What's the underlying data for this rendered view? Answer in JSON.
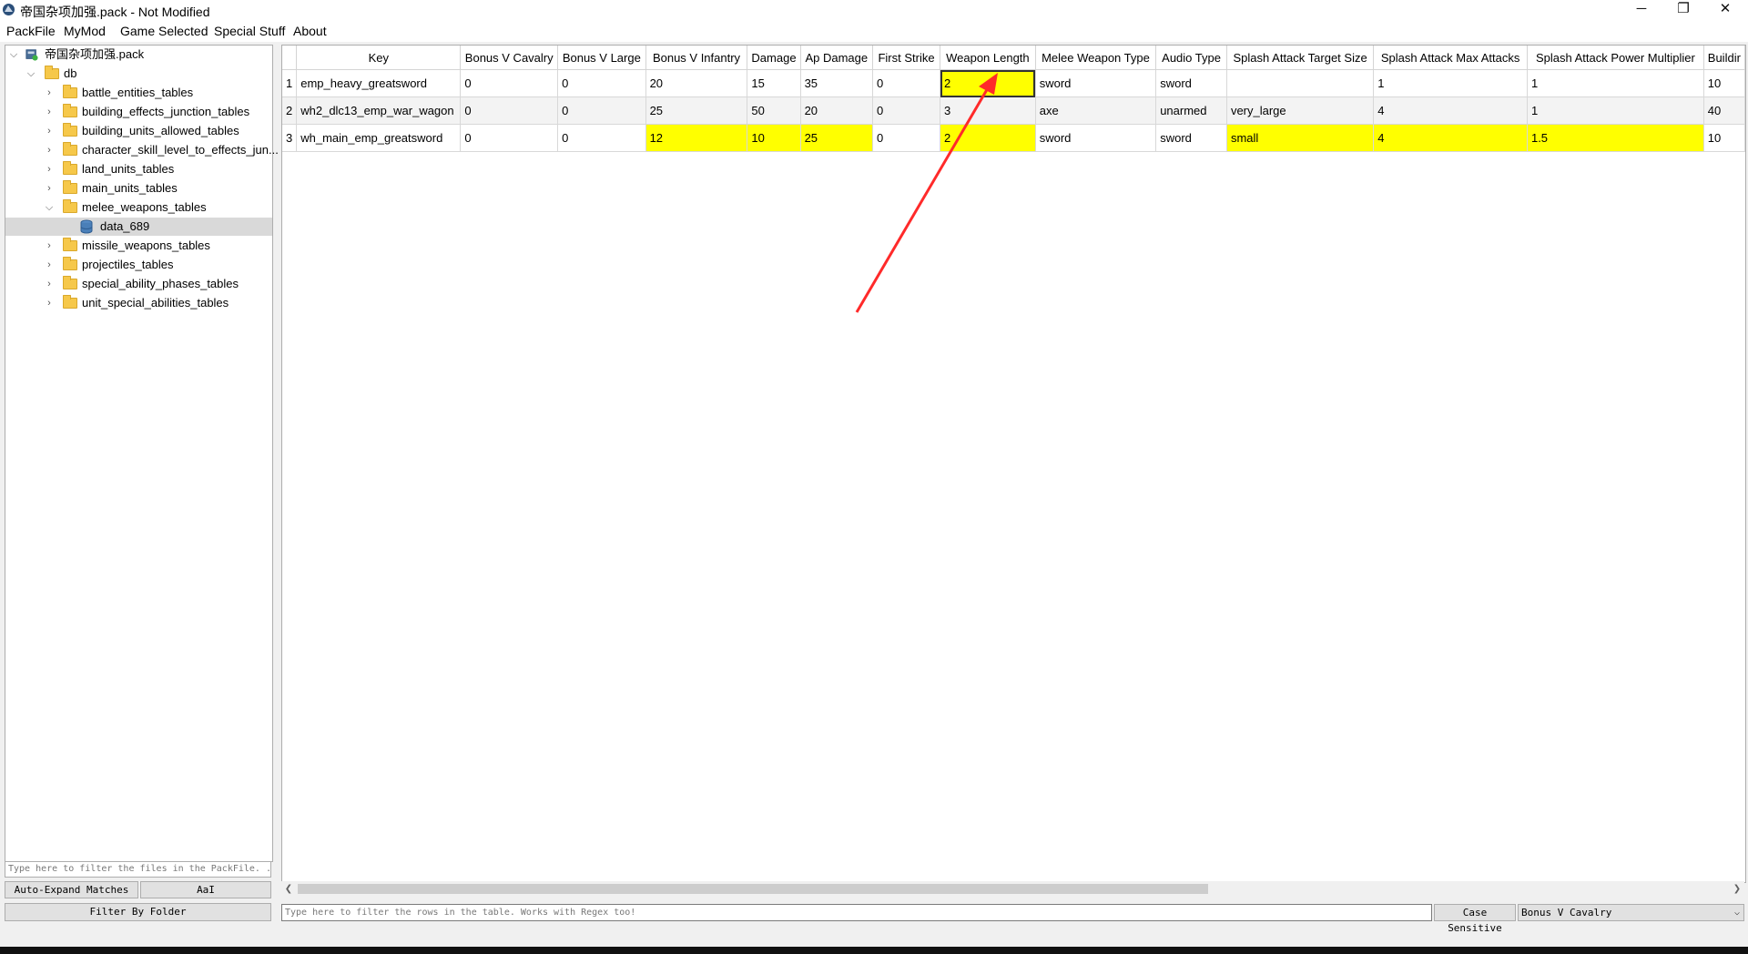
{
  "window": {
    "title": "帝国杂项加强.pack - Not Modified",
    "minimize": "─",
    "maximize": "❐",
    "close": "✕"
  },
  "menu": [
    {
      "label": "PackFile"
    },
    {
      "label": "MyMod"
    },
    {
      "label": "Game Selected"
    },
    {
      "label": "Special Stuff"
    },
    {
      "label": "About"
    }
  ],
  "tree": {
    "root": "帝国杂项加强.pack",
    "db": "db",
    "items": [
      "battle_entities_tables",
      "building_effects_junction_tables",
      "building_units_allowed_tables",
      "character_skill_level_to_effects_jun...",
      "land_units_tables",
      "main_units_tables",
      "melee_weapons_tables",
      "data_689",
      "missile_weapons_tables",
      "projectiles_tables",
      "special_ability_phases_tables",
      "unit_special_abilities_tables"
    ],
    "filter_placeholder": "Type here to filter the files in the PackFile. ...",
    "auto_expand": "Auto-Expand Matches",
    "case": "AaI",
    "filter_by_folder": "Filter By Folder"
  },
  "table": {
    "columns": [
      "Key",
      "Bonus V Cavalry",
      "Bonus V Large",
      "Bonus V Infantry",
      "Damage",
      "Ap Damage",
      "First Strike",
      "Weapon Length",
      "Melee Weapon Type",
      "Audio Type",
      "Splash Attack Target Size",
      "Splash Attack Max Attacks",
      "Splash Attack Power Multiplier",
      "Buildir"
    ],
    "rows": [
      [
        "1",
        "emp_heavy_greatsword",
        "0",
        "0",
        "20",
        "15",
        "35",
        "0",
        "2",
        "sword",
        "sword",
        "",
        "1",
        "1",
        "10"
      ],
      [
        "2",
        "wh2_dlc13_emp_war_wagon",
        "0",
        "0",
        "25",
        "50",
        "20",
        "0",
        "3",
        "axe",
        "unarmed",
        "very_large",
        "4",
        "1",
        "40"
      ],
      [
        "3",
        "wh_main_emp_greatsword",
        "0",
        "0",
        "12",
        "10",
        "25",
        "0",
        "2",
        "sword",
        "sword",
        "small",
        "4",
        "1.5",
        "10"
      ]
    ],
    "row_filter_placeholder": "Type here to filter the rows in the table. Works with Regex too!",
    "case_sensitive": "Case Sensitive",
    "filter_column": "Bonus V Cavalry"
  },
  "colors": {
    "highlight": "#ffff00",
    "arrow": "#ff2a2a",
    "folder": "#f6c84a"
  }
}
